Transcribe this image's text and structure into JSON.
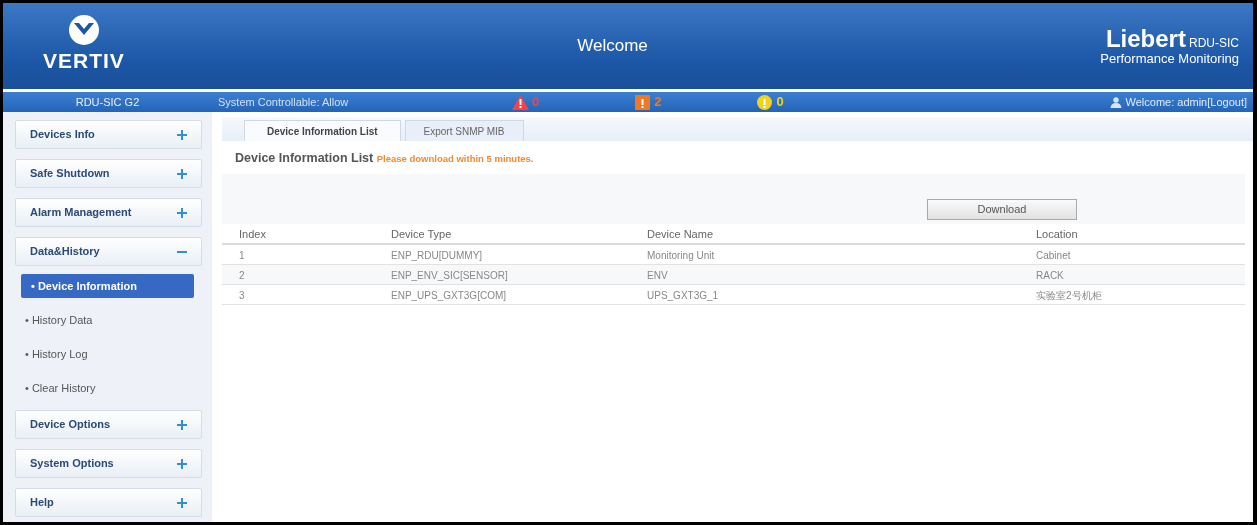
{
  "header": {
    "logo_text": "VERTIV",
    "title": "Welcome",
    "brand": "Liebert",
    "brand_suffix": "RDU-SIC",
    "brand_subtitle": "Performance Monitoring"
  },
  "status_bar": {
    "device": "RDU-SIC G2",
    "controllable": "System Controllable:  Allow",
    "alarms": [
      {
        "kind": "critical",
        "count": "0",
        "color": "#ff4040"
      },
      {
        "kind": "major",
        "count": "2",
        "color": "#f07820"
      },
      {
        "kind": "minor",
        "count": "0",
        "color": "#f2d21e"
      }
    ],
    "welcome": "Welcome: admin[Logout]"
  },
  "sidebar": {
    "items": [
      {
        "label": "Devices Info",
        "expanded": false
      },
      {
        "label": "Safe Shutdown",
        "expanded": false
      },
      {
        "label": "Alarm Management",
        "expanded": false
      },
      {
        "label": "Data&History",
        "expanded": true,
        "children": [
          {
            "label": "• Device Information",
            "selected": true
          },
          {
            "label": "• History Data",
            "selected": false
          },
          {
            "label": "• History Log",
            "selected": false
          },
          {
            "label": "• Clear History",
            "selected": false
          }
        ]
      },
      {
        "label": "Device Options",
        "expanded": false
      },
      {
        "label": "System Options",
        "expanded": false
      },
      {
        "label": "Help",
        "expanded": false
      }
    ]
  },
  "tabs": [
    {
      "label": "Device Information List",
      "selected": true
    },
    {
      "label": "Export SNMP MIB",
      "selected": false
    }
  ],
  "section": {
    "title": "Device Information List",
    "note": "Please download within 5 minutes."
  },
  "download_button": "Download",
  "table": {
    "columns": [
      "Index",
      "Device Type",
      "Device Name",
      "Location"
    ],
    "rows": [
      [
        "1",
        "ENP_RDU[DUMMY]",
        "Monitoring Unit",
        "Cabinet"
      ],
      [
        "2",
        "ENP_ENV_SIC[SENSOR]",
        "ENV",
        "RACK"
      ],
      [
        "3",
        "ENP_UPS_GXT3G[COM]",
        "UPS_GXT3G_1",
        "实验室2号机柜"
      ]
    ]
  }
}
